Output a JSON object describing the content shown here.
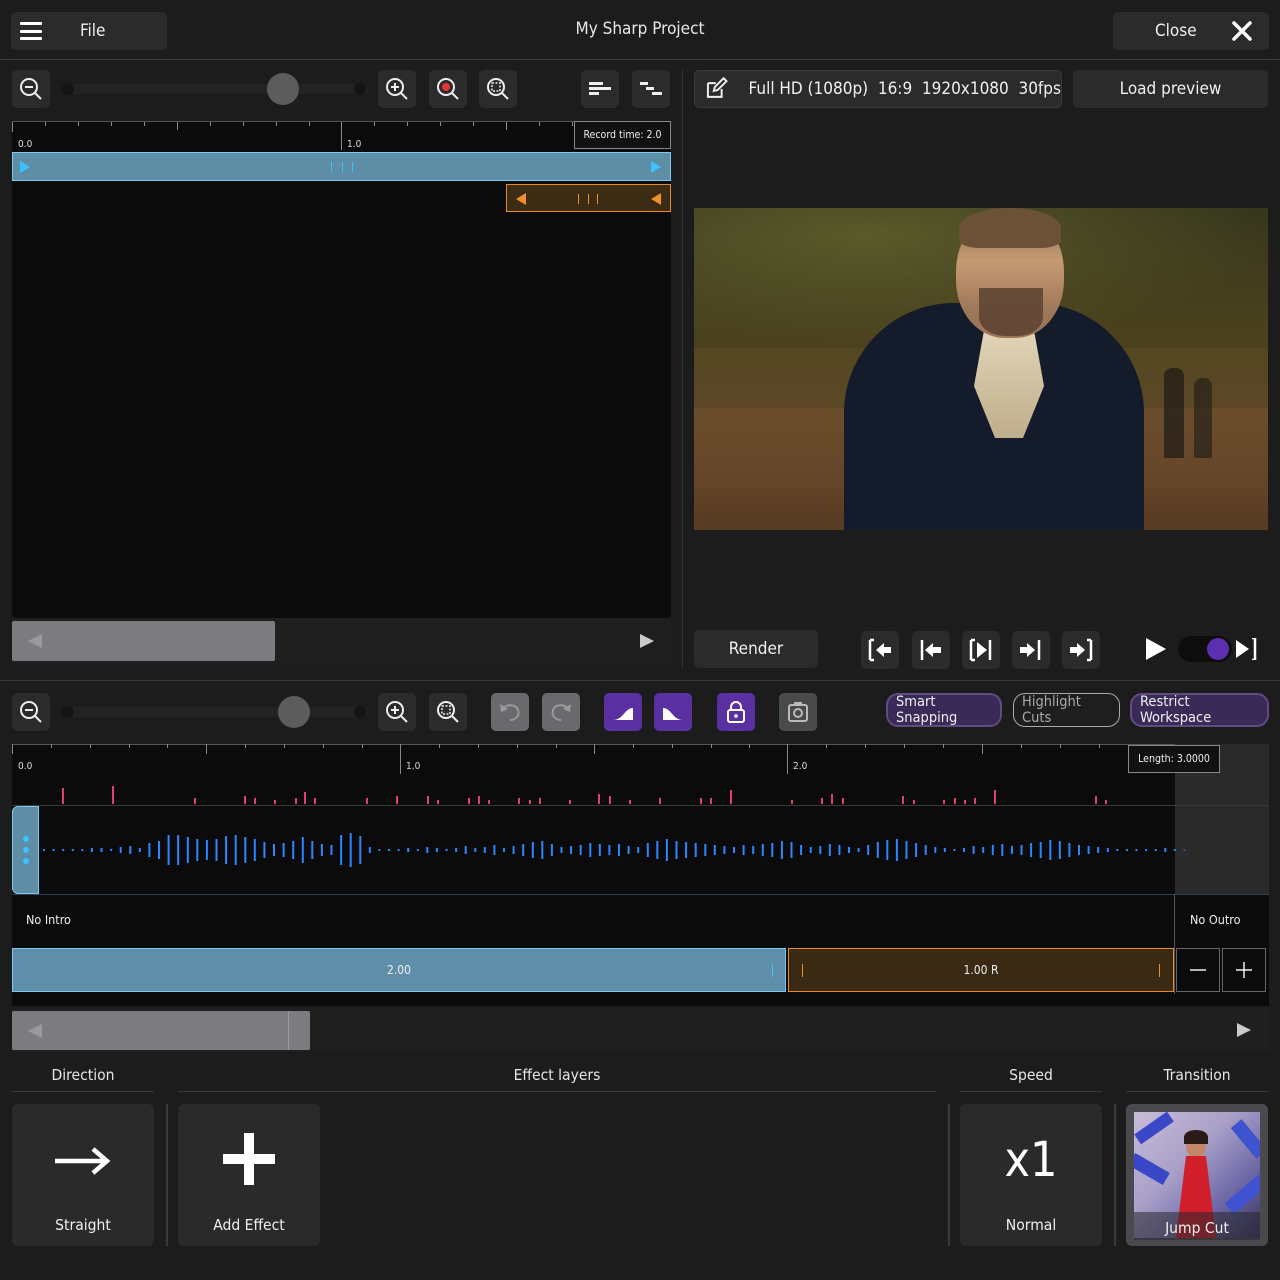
{
  "header": {
    "file_label": "File",
    "title": "My Sharp Project",
    "close_label": "Close"
  },
  "top_timeline": {
    "tick_labels": [
      "0.0",
      "1.0"
    ],
    "record_time": "Record time: 2.0"
  },
  "preview": {
    "format": "Full HD (1080p)  16:9  1920x1080  30fps",
    "load_preview_label": "Load preview",
    "render_label": "Render"
  },
  "toggles": {
    "smart_snapping": "Smart Snapping",
    "highlight_cuts": "Highlight Cuts",
    "restrict_workspace": "Restrict Workspace"
  },
  "bottom_timeline": {
    "tick_labels": [
      "0.0",
      "1.0",
      "2.0"
    ],
    "length": "Length: 3.0000",
    "intro_label": "No Intro",
    "outro_label": "No Outro",
    "clip1_label": "2.00",
    "clip2_label": "1.00 R"
  },
  "sections": {
    "direction": {
      "heading": "Direction",
      "value": "Straight"
    },
    "effect_layers": {
      "heading": "Effect layers",
      "add_label": "Add Effect"
    },
    "speed": {
      "heading": "Speed",
      "multiplier": "x1",
      "value": "Normal"
    },
    "transition": {
      "heading": "Transition",
      "value": "Jump Cut"
    }
  },
  "colors": {
    "background": "#1c1c1d",
    "panel": "#0b0b0b",
    "accent_blue": "#5f8fa8",
    "accent_orange": "#e8892b",
    "accent_purple": "#5a2fa0",
    "waveform": "#2c86ff",
    "marker_red": "#e0406a"
  }
}
